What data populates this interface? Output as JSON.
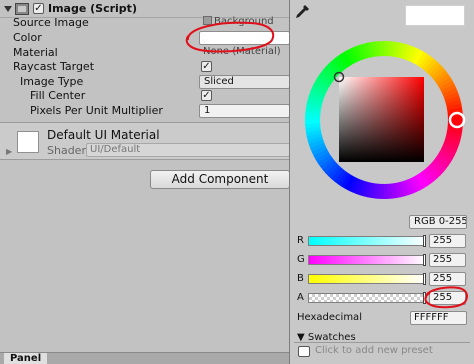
{
  "inspector": {
    "component": {
      "title": "Image (Script)",
      "enabled": true
    },
    "properties": [
      {
        "label": "Source Image",
        "value": "Background"
      },
      {
        "label": "Color",
        "value": ""
      },
      {
        "label": "Material",
        "value": "None (Material)"
      },
      {
        "label": "Raycast Target",
        "checked": true
      },
      {
        "label": "Image Type",
        "value": "Sliced"
      },
      {
        "label": "Fill Center",
        "checked": true
      },
      {
        "label": "Pixels Per Unit Multiplier",
        "value": "1"
      }
    ],
    "material": {
      "title": "Default UI Material",
      "shader_label": "Shader",
      "shader_value": "UI/Default"
    },
    "add_component_label": "Add Component",
    "panel_tab": "Panel"
  },
  "color_picker": {
    "preview_color": "#ffffff",
    "mode": "RGB 0-255",
    "channels": [
      {
        "label": "R",
        "value": "255",
        "gradient_from": "#00ffff",
        "gradient_to": "#ffffff"
      },
      {
        "label": "G",
        "value": "255",
        "gradient_from": "#ff00ff",
        "gradient_to": "#ffffff"
      },
      {
        "label": "B",
        "value": "255",
        "gradient_from": "#ffff00",
        "gradient_to": "#ffffff"
      },
      {
        "label": "A",
        "value": "255"
      }
    ],
    "hex_label": "Hexadecimal",
    "hex_value": "FFFFFF",
    "swatches_label": "Swatches",
    "preset_text": "Click to add new preset"
  },
  "annotation_color": "#e0101a"
}
